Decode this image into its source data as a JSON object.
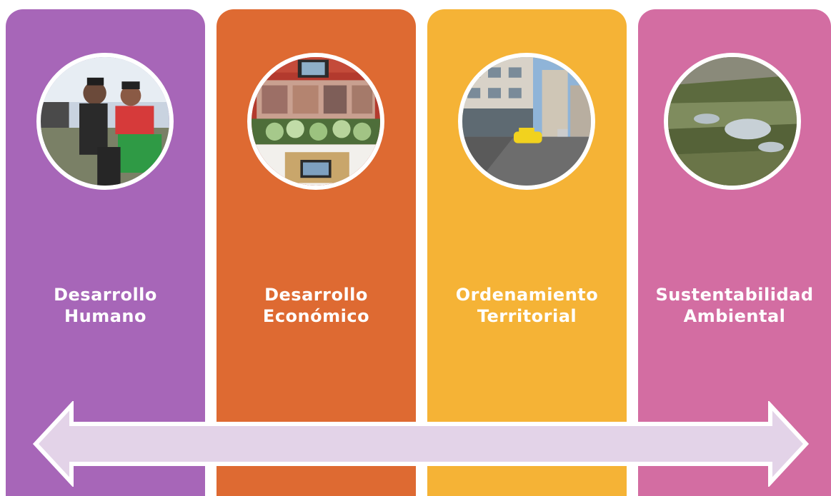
{
  "pillars": [
    {
      "line1": "Desarrollo",
      "line2": "Humano",
      "color": "#a766b8",
      "icon": "people-photo"
    },
    {
      "line1": "Desarrollo",
      "line2": "Económico",
      "color": "#de6a32",
      "icon": "market-produce-photo"
    },
    {
      "line1": "Ordenamiento",
      "line2": "Territorial",
      "color": "#f5b336",
      "icon": "city-street-photo"
    },
    {
      "line1": "Sustentabilidad",
      "line2": "Ambiental",
      "color": "#d36da2",
      "icon": "landscape-photo"
    }
  ],
  "arrow": {
    "fill": "#e3d3e8",
    "stroke": "#ffffff",
    "direction": "bidirectional"
  }
}
